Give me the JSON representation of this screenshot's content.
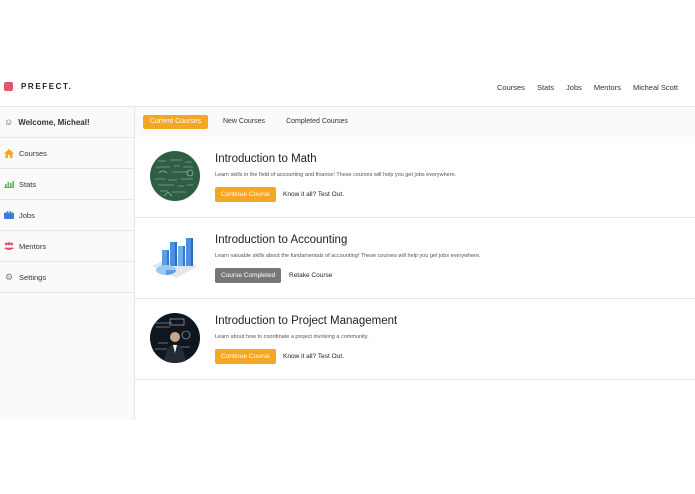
{
  "brand": {
    "name": "PREFECT.",
    "mark_color": "#e0566b"
  },
  "topnav": {
    "items": [
      "Courses",
      "Stats",
      "Jobs",
      "Mentors",
      "Micheal Scott"
    ]
  },
  "sidebar": {
    "welcome": "Welcome, Micheal!",
    "items": [
      {
        "label": "Courses",
        "icon": "home-icon",
        "color": "#f5a623"
      },
      {
        "label": "Stats",
        "icon": "bar-chart-icon",
        "color": "#5cb85c"
      },
      {
        "label": "Jobs",
        "icon": "briefcase-icon",
        "color": "#3b7dd8"
      },
      {
        "label": "Mentors",
        "icon": "users-icon",
        "color": "#e0566b"
      },
      {
        "label": "Settings",
        "icon": "gear-icon",
        "color": "#777777"
      }
    ]
  },
  "tabs": [
    "Current Courses",
    "New Courses",
    "Completed Courses"
  ],
  "accent_color": "#f5a623",
  "courses": [
    {
      "title": "Introduction to Math",
      "description": "Learn skills in the field of accounting and finance! These courses will help you get jobs everywhere.",
      "primary_label": "Continue Course",
      "secondary_label": "Know it all? Test Out.",
      "thumbnail": "chalkboard-math-image"
    },
    {
      "title": "Introduction to Accounting",
      "description": "Learn valuable skills about the fundamentals of accounting! These courses will help you get jobs everywhere.",
      "primary_label": "Course Completed",
      "secondary_label": "Retake Course",
      "thumbnail": "3d-chart-image"
    },
    {
      "title": "Introduction to Project Management",
      "description": "Learn about how to coordinate a project involving a community.",
      "primary_label": "Continue Course",
      "secondary_label": "Know it all? Test Out.",
      "thumbnail": "project-management-image"
    }
  ]
}
